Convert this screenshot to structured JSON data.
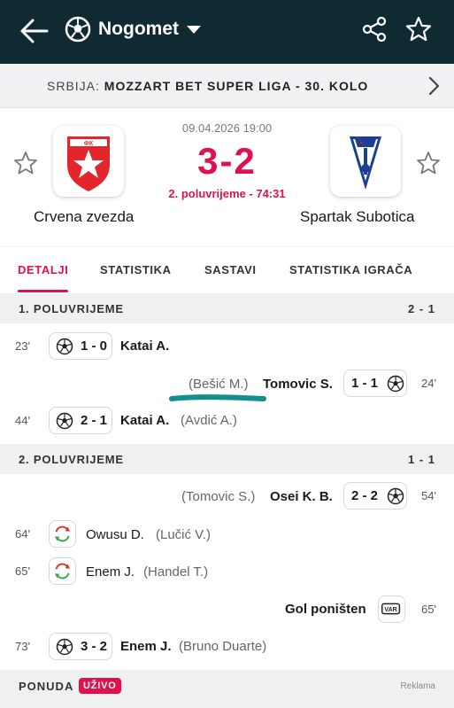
{
  "header": {
    "title": "Nogomet",
    "back_icon": "back-arrow-icon",
    "sport_icon": "soccer-ball-icon",
    "share_icon": "share-icon",
    "favorite_icon": "star-outline-icon",
    "bg": "#0f2a33"
  },
  "league": {
    "country": "SRBIJA:",
    "name": "MOZZART BET SUPER LIGA - 30. KOLO"
  },
  "match": {
    "datetime": "09.04.2026 19:00",
    "score": "3-2",
    "status": "2. poluvrijeme - 74:31",
    "home": {
      "name": "Crvena zvezda"
    },
    "away": {
      "name": "Spartak Subotica"
    },
    "accent": "#e0114f"
  },
  "tabs": [
    "DETALJI",
    "STATISTIKA",
    "SASTAVI",
    "STATISTIKA IGRAČA"
  ],
  "sections": [
    {
      "label": "1. POLUVRIJEME",
      "score": "2 - 1"
    },
    {
      "label": "2. POLUVRIJEME",
      "score": "1 - 1"
    }
  ],
  "events": {
    "e1": {
      "minute": "23'",
      "score": "1 - 0",
      "player": "Katai A."
    },
    "e2": {
      "minute": "24'",
      "score": "1 - 1",
      "player": "Tomovic S.",
      "assist": "(Bešić M.)"
    },
    "e3": {
      "minute": "44'",
      "score": "2 - 1",
      "player": "Katai A.",
      "assist": "(Avdić A.)"
    },
    "e4": {
      "minute": "54'",
      "score": "2 - 2",
      "player": "Osei K. B.",
      "assist": "(Tomovic S.)"
    },
    "e5": {
      "minute": "64'",
      "player": "Owusu D.",
      "assist": "(Lučić V.)"
    },
    "e6": {
      "minute": "65'",
      "player": "Enem J.",
      "assist": "(Handel T.)"
    },
    "e7": {
      "minute": "65'",
      "player": "Gol poništen",
      "var": "VAR"
    },
    "e8": {
      "minute": "73'",
      "score": "3 - 2",
      "player": "Enem J.",
      "assist": "(Bruno Duarte)"
    }
  },
  "footer": {
    "ponuda": "PONUDA",
    "live": "UŽIVO",
    "ad": "Reklama"
  }
}
